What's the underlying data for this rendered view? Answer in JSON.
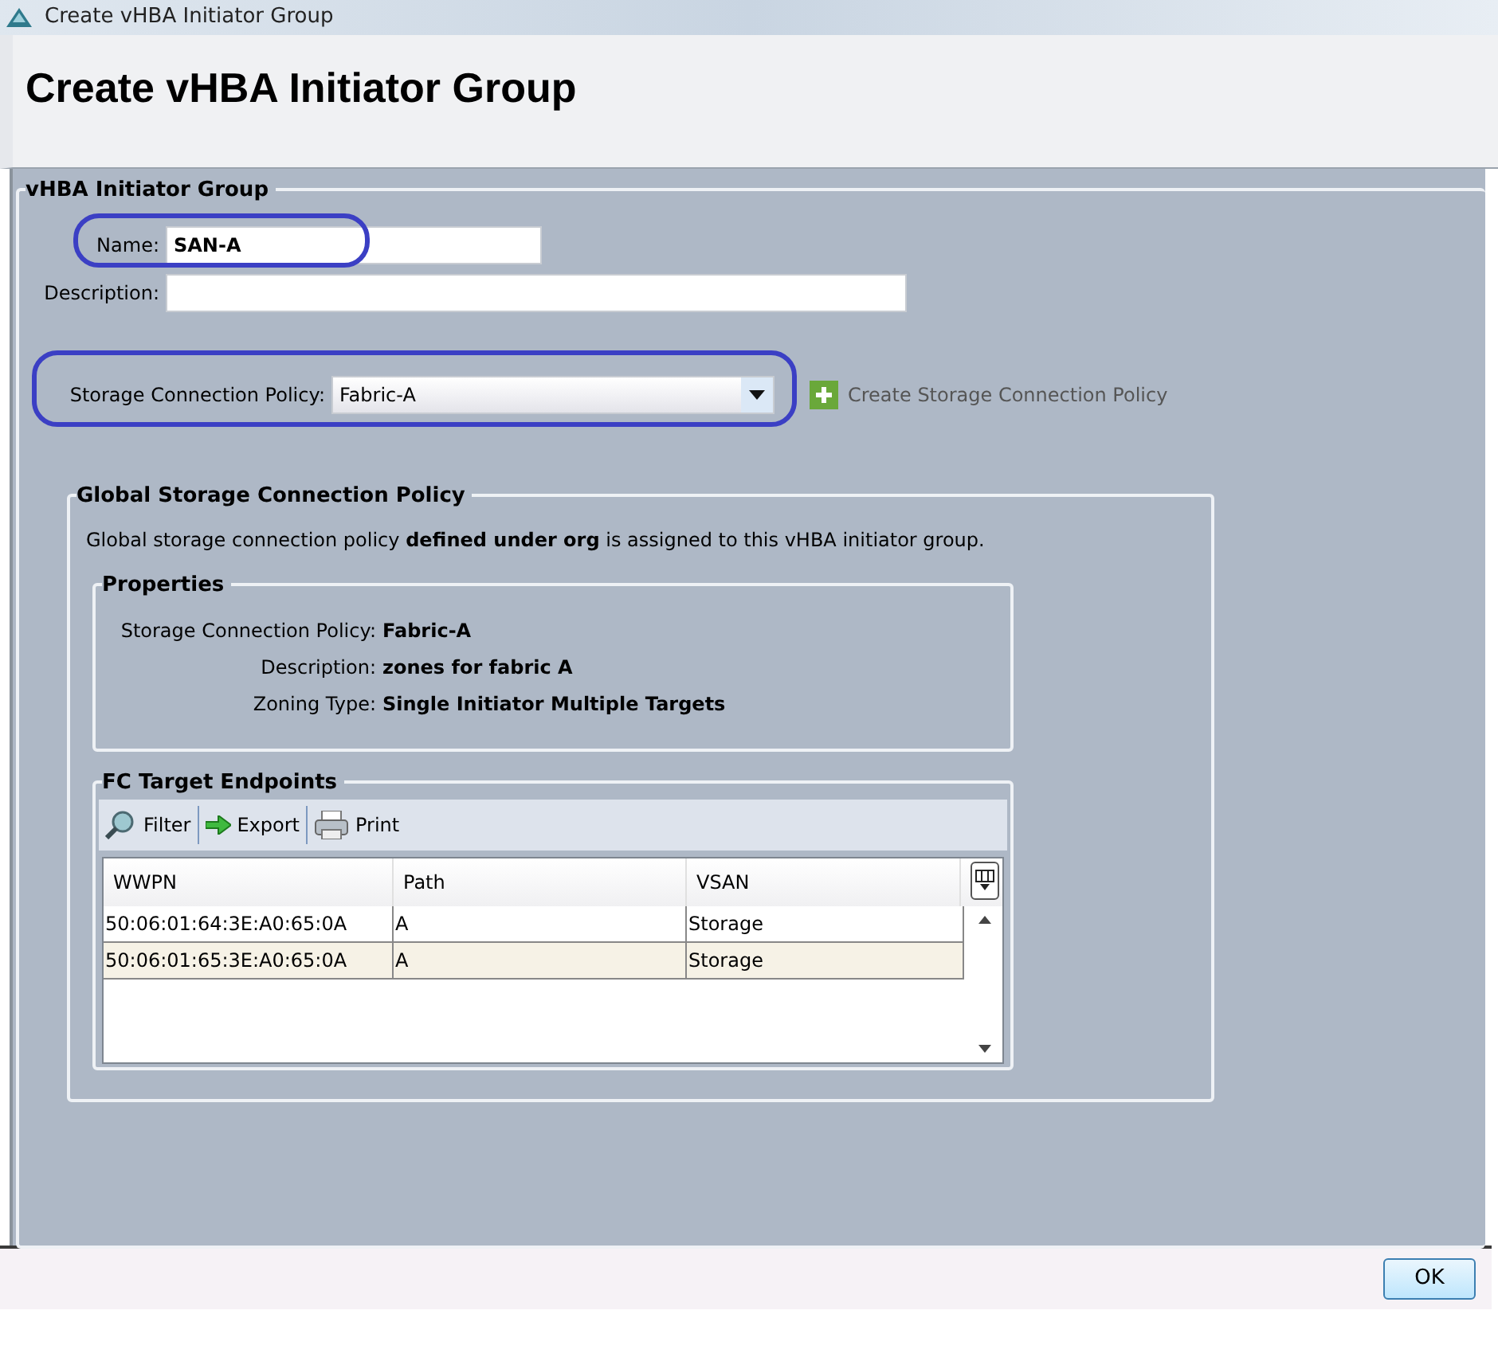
{
  "window": {
    "title": "Create vHBA Initiator Group"
  },
  "header": {
    "title": "Create vHBA Initiator Group"
  },
  "group": {
    "legend": "vHBA Initiator Group",
    "fields": [
      {
        "kind": "text",
        "label": "Name:",
        "value": "SAN-A",
        "highlighted": true
      },
      {
        "kind": "text",
        "label": "Description:",
        "highlighted": false
      },
      {
        "kind": "select",
        "label": "Storage Connection Policy:",
        "value": "Fabric-A",
        "highlighted": true
      }
    ],
    "create_link": "Create Storage Connection Policy"
  },
  "global_policy": {
    "legend": "Global Storage Connection Policy",
    "note": "Global storage connection policy **defined under org** is assigned to this vHBA initiator group.",
    "properties": {
      "legend": "Properties",
      "items": [
        {
          "label": "Storage Connection Policy:",
          "value": "Fabric-A"
        },
        {
          "label": "Description:",
          "value": "zones for fabric A"
        },
        {
          "label": "Zoning Type:",
          "value": "Single Initiator Multiple Targets"
        }
      ]
    },
    "endpoints": {
      "legend": "FC Target Endpoints",
      "toolbar": [
        {
          "kind": "filter",
          "label": "Filter"
        },
        {
          "kind": "export",
          "label": "Export"
        },
        {
          "kind": "print",
          "label": "Print"
        }
      ],
      "columns": [
        "WWPN",
        "Path",
        "VSAN"
      ],
      "rows": [
        {
          "cells": [
            "50:06:01:64:3E:A0:65:0A",
            "A",
            "Storage"
          ],
          "selected": false
        },
        {
          "cells": [
            "50:06:01:65:3E:A0:65:0A",
            "A",
            "Storage"
          ],
          "selected": true
        }
      ]
    }
  },
  "footer": {
    "buttons": [
      "OK"
    ]
  }
}
